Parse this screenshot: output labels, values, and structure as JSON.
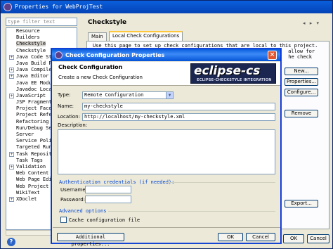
{
  "outer": {
    "title": "Properties for WebProjTest",
    "filter_placeholder": "type filter text",
    "tree": [
      {
        "label": "Resource",
        "expandable": false
      },
      {
        "label": "Builders",
        "expandable": false
      },
      {
        "label": "Checkstyle",
        "expandable": false,
        "selected": true
      },
      {
        "label": "Checkstyle",
        "expandable": false
      },
      {
        "label": "Java Code Style",
        "expandable": true
      },
      {
        "label": "Java Build Path",
        "expandable": false
      },
      {
        "label": "Java Compiler",
        "expandable": true
      },
      {
        "label": "Java Editor",
        "expandable": true
      },
      {
        "label": "Java EE Module",
        "expandable": false
      },
      {
        "label": "Javadoc Locat",
        "expandable": false
      },
      {
        "label": "JavaScript",
        "expandable": true
      },
      {
        "label": "JSP Fragment",
        "expandable": false
      },
      {
        "label": "Project Facets",
        "expandable": false
      },
      {
        "label": "Project Refer",
        "expandable": false
      },
      {
        "label": "Refactoring Hi",
        "expandable": false
      },
      {
        "label": "Run/Debug Sett",
        "expandable": false
      },
      {
        "label": "Server",
        "expandable": false
      },
      {
        "label": "Service Polici",
        "expandable": false
      },
      {
        "label": "Targeted Runti",
        "expandable": false
      },
      {
        "label": "Task Repositor",
        "expandable": true
      },
      {
        "label": "Task Tags",
        "expandable": false
      },
      {
        "label": "Validation",
        "expandable": true
      },
      {
        "label": "Web Content Se",
        "expandable": false
      },
      {
        "label": "Web Page Edito",
        "expandable": false
      },
      {
        "label": "Web Project Se",
        "expandable": false
      },
      {
        "label": "WikiText",
        "expandable": false
      },
      {
        "label": "XDoclet",
        "expandable": true
      }
    ],
    "page_title": "Checkstyle",
    "tabs": [
      "Main",
      "Local Check Configurations"
    ],
    "desc_line1": "Use this page to set up check configurations that are local to this project.",
    "desc_line2_right": "allow for",
    "desc_line3_right": "he check",
    "side_buttons": [
      "New...",
      "Properties...",
      "Configure...",
      "Remove"
    ],
    "export_button": "Export...",
    "ok_button": "OK",
    "cancel_button": "Cancel"
  },
  "dialog": {
    "title": "Check Configuration Properties",
    "banner_title": "Check Configuration",
    "banner_subtitle": "Create a new Check Configuration",
    "logo_text": "eclipse-cs",
    "logo_subtext": "ECLIPSE-CHECKSTYLE INTEGRATION",
    "type_label": "Type:",
    "type_value": "Remote Configuration",
    "name_label": "Name:",
    "name_value": "my-checkstyle",
    "location_label": "Location:",
    "location_value": "http://localhost/my-checkstyle.xml",
    "description_label": "Description:",
    "auth_group": "Authentication credentials (if needed):",
    "username_label": "Username:",
    "password_label": "Password:",
    "advanced_group": "Advanced options",
    "cache_label": "Cache configuration file",
    "additional_button": "Additional properties...",
    "ok_button": "OK",
    "cancel_button": "Cancel"
  },
  "colors": {
    "titlebar": "#0453d6",
    "dialog_bg": "#ece9d8",
    "group_label": "#0046d5",
    "close_button": "#e0552f"
  },
  "icons": [
    "app-icon",
    "help-icon",
    "close-icon",
    "dropdown-arrow-icon",
    "expand-icon"
  ]
}
